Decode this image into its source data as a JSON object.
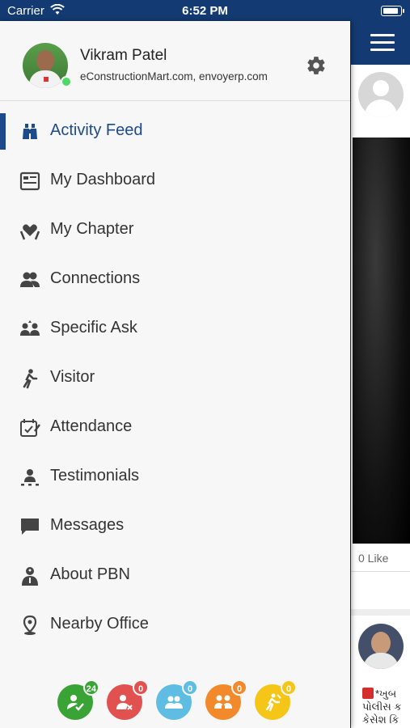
{
  "status_bar": {
    "carrier": "Carrier",
    "time": "6:52 PM",
    "battery_level": 1.0
  },
  "profile": {
    "name": "Vikram Patel",
    "company": "eConstructionMart.com, envoyerp.com",
    "online": true
  },
  "menu": [
    {
      "label": "Activity Feed",
      "icon": "binoculars-icon",
      "active": true
    },
    {
      "label": "My Dashboard",
      "icon": "dashboard-icon",
      "active": false
    },
    {
      "label": "My Chapter",
      "icon": "chapter-icon",
      "active": false
    },
    {
      "label": "Connections",
      "icon": "connections-icon",
      "active": false
    },
    {
      "label": "Specific Ask",
      "icon": "specific-ask-icon",
      "active": false
    },
    {
      "label": "Visitor",
      "icon": "visitor-icon",
      "active": false
    },
    {
      "label": "Attendance",
      "icon": "attendance-icon",
      "active": false
    },
    {
      "label": "Testimonials",
      "icon": "testimonials-icon",
      "active": false
    },
    {
      "label": "Messages",
      "icon": "messages-icon",
      "active": false
    },
    {
      "label": "About PBN",
      "icon": "about-icon",
      "active": false
    },
    {
      "label": "Nearby Office",
      "icon": "location-pin-icon",
      "active": false
    }
  ],
  "badges": [
    {
      "icon": "check-user-icon",
      "count": "24",
      "color": "#3aa335",
      "count_color": "#3aa335"
    },
    {
      "icon": "user-remove-icon",
      "count": "0",
      "color": "#e05150",
      "count_color": "#e05150"
    },
    {
      "icon": "users-group-icon",
      "count": "0",
      "color": "#5fbde3",
      "count_color": "#5fbde3"
    },
    {
      "icon": "referral-icon",
      "count": "0",
      "color": "#f28a2b",
      "count_color": "#f28a2b"
    },
    {
      "icon": "visitor-walk-icon",
      "count": "0",
      "color": "#f5c518",
      "count_color": "#f5c518"
    }
  ],
  "background_feed": {
    "likes": "0  Like",
    "snippet_line1": "*ખુબ",
    "snippet_line2": "પોલીસ ક",
    "snippet_line3": "કેસેશ કિ"
  },
  "colors": {
    "brand": "#133a72",
    "active": "#1d4a8a",
    "drawer_bg": "#f7f7f7"
  }
}
